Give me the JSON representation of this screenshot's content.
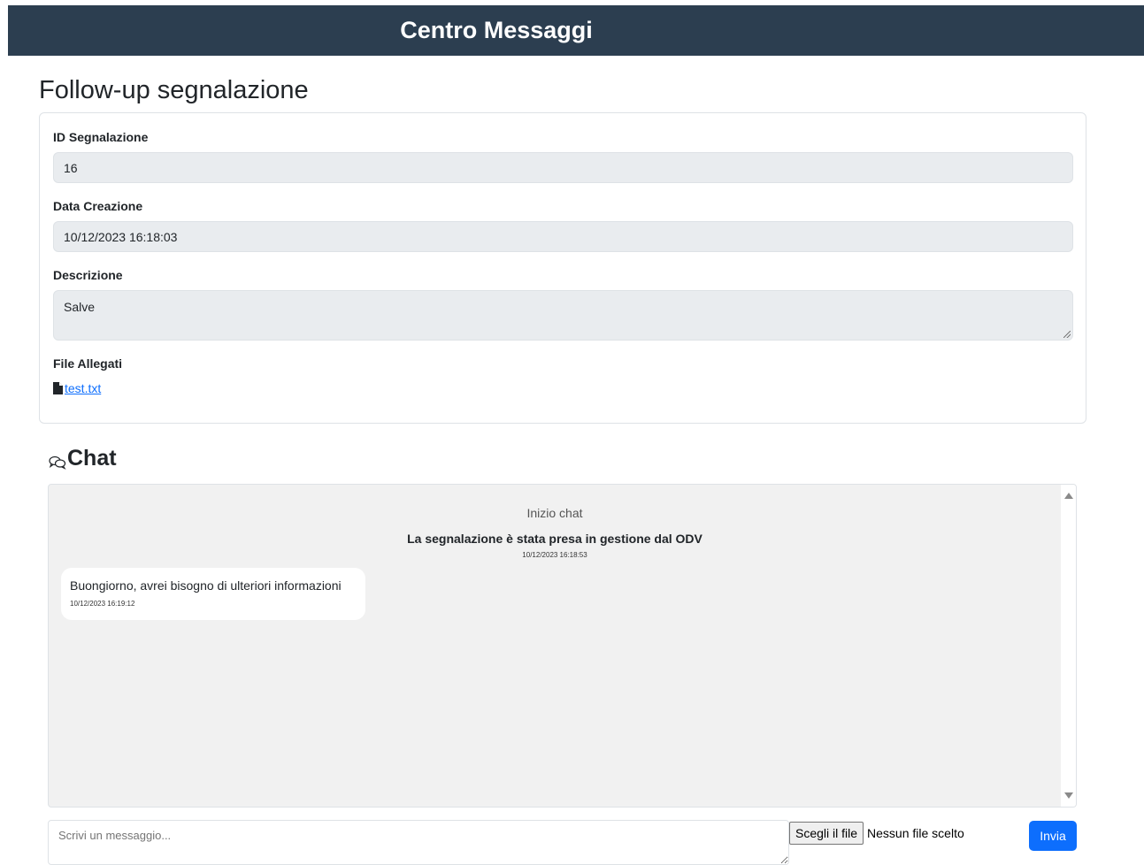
{
  "header": {
    "title": "Centro Messaggi"
  },
  "page": {
    "title": "Follow-up segnalazione"
  },
  "report": {
    "id_label": "ID Segnalazione",
    "id_value": "16",
    "date_label": "Data Creazione",
    "date_value": "10/12/2023 16:18:03",
    "description_label": "Descrizione",
    "description_value": "Salve",
    "attachments_label": "File Allegati",
    "attachments": [
      {
        "name": "test.txt",
        "icon": "file-icon"
      }
    ]
  },
  "chat": {
    "title": "Chat",
    "icon": "chat-bubbles-icon",
    "start_text": "Inizio chat",
    "system_message": {
      "text": "La segnalazione è stata presa in gestione dal ODV",
      "time": "10/12/2023 16:18:53"
    },
    "messages": [
      {
        "text": "Buongiorno, avrei bisogno di ulteriori informazioni",
        "time": "10/12/2023 16:19:12"
      }
    ]
  },
  "composer": {
    "placeholder": "Scrivi un messaggio...",
    "file_button_label": "Scegli il file",
    "file_status": "Nessun file scelto",
    "send_label": "Invia"
  },
  "colors": {
    "header_bg": "#2c3e50",
    "accent": "#0d6efd",
    "chat_bg": "#f1f1f1"
  }
}
